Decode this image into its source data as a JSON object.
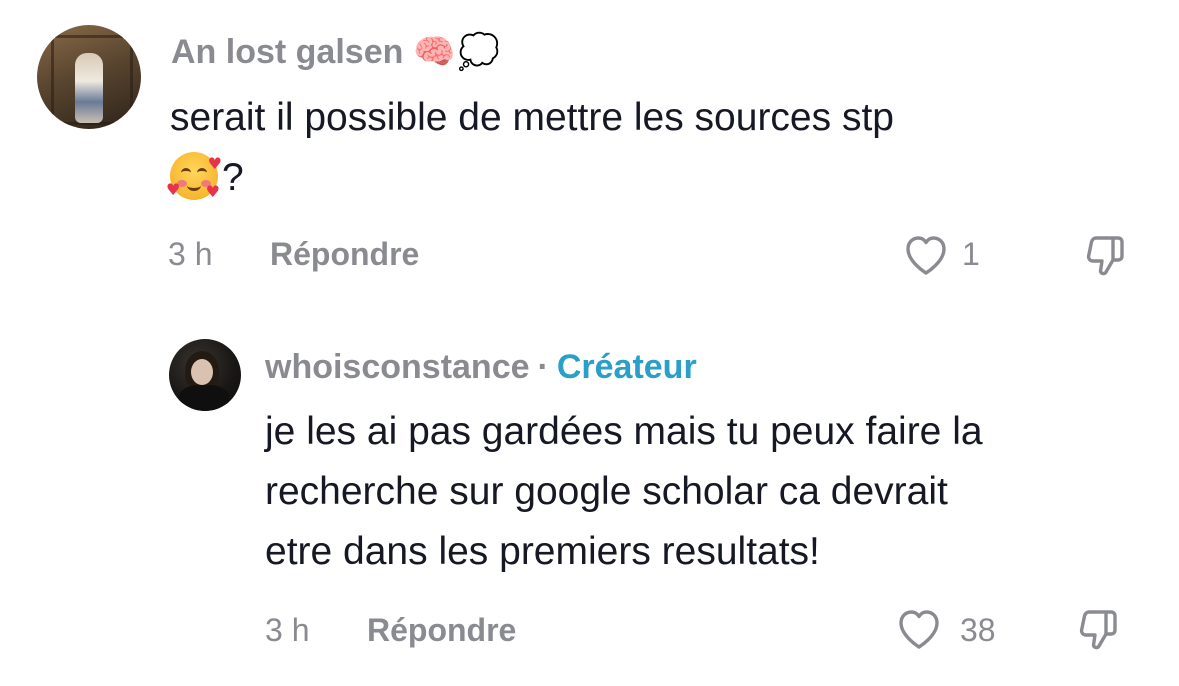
{
  "comments": [
    {
      "username": "An lost galsen",
      "username_emojis": [
        "brain-icon",
        "thought-bubble-icon"
      ],
      "text_line1": "serait il possible de mettre les sources stp",
      "text_line2_suffix": "?",
      "inline_emoji": "smiling-face-with-hearts-icon",
      "time": "3 h",
      "reply_label": "Répondre",
      "likes": "1"
    },
    {
      "username": "whoisconstance",
      "separator": "·",
      "badge": "Créateur",
      "text_lines": [
        "je les ai pas gardées mais tu peux faire la",
        "recherche sur google scholar ca devrait",
        "etre dans les premiers resultats!"
      ],
      "time": "3 h",
      "reply_label": "Répondre",
      "likes": "38"
    }
  ],
  "colors": {
    "text": "#161823",
    "muted": "#8a8b91",
    "creator_badge": "#2a9fc7",
    "background": "#ffffff"
  }
}
